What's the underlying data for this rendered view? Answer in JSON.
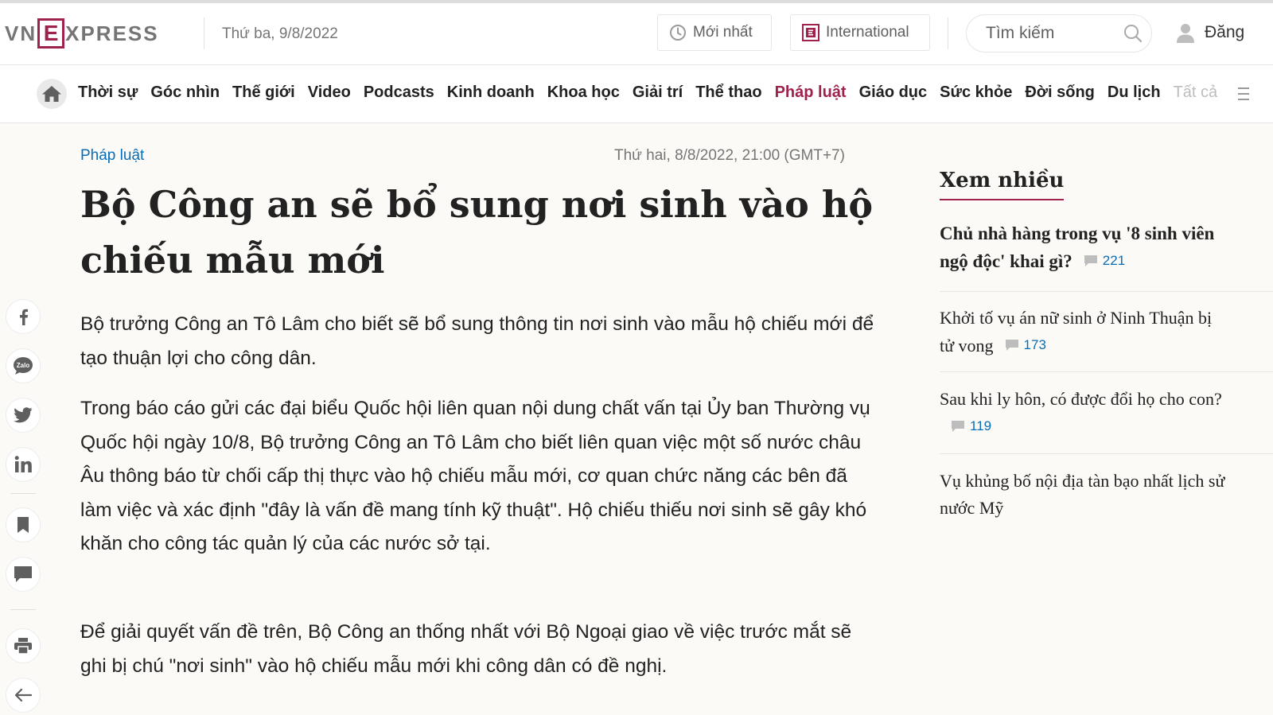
{
  "header": {
    "logo": {
      "left": "VN",
      "box": "E",
      "right": "XPRESS"
    },
    "date": "Thứ ba, 9/8/2022",
    "latest_label": "Mới nhất",
    "latest_icon": "clock-icon",
    "international_label": "International",
    "international_icon": "e-logo-icon",
    "search_placeholder": "Tìm kiếm",
    "login_label": "Đăng"
  },
  "nav": {
    "items": [
      "Thời sự",
      "Góc nhìn",
      "Thế giới",
      "Video",
      "Podcasts",
      "Kinh doanh",
      "Khoa học",
      "Giải trí",
      "Thể thao",
      "Pháp luật",
      "Giáo dục",
      "Sức khỏe",
      "Đời sống",
      "Du lịch"
    ],
    "active": "Pháp luật",
    "all_label": "Tất cả"
  },
  "article": {
    "category": "Pháp luật",
    "published": "Thứ hai, 8/8/2022, 21:00 (GMT+7)",
    "title": "Bộ Công an sẽ bổ sung nơi sinh vào hộ chiếu mẫu mới",
    "lead": "Bộ trưởng Công an Tô Lâm cho biết sẽ bổ sung thông tin nơi sinh vào mẫu hộ chiếu mới để tạo thuận lợi cho công dân.",
    "paragraphs": [
      "Trong báo cáo gửi các đại biểu Quốc hội liên quan nội dung chất vấn tại Ủy ban Thường vụ Quốc hội ngày 10/8, Bộ trưởng Công an Tô Lâm cho biết liên quan việc một số nước châu Âu thông báo từ chối cấp thị thực vào hộ chiếu mẫu mới, cơ quan chức năng các bên đã làm việc và xác định \"đây là vấn đề mang tính kỹ thuật\". Hộ chiếu thiếu nơi sinh sẽ gây khó khăn cho công tác quản lý của các nước sở tại.",
      "Để giải quyết vấn đề trên, Bộ Công an thống nhất với Bộ Ngoại giao về việc trước mắt sẽ ghi bị chú \"nơi sinh\" vào hộ chiếu mẫu mới khi công dân có đề nghị."
    ]
  },
  "social": [
    "facebook-icon",
    "zalo-icon",
    "twitter-icon",
    "linkedin-icon",
    "bookmark-icon",
    "comment-icon",
    "print-icon",
    "back-arrow-icon"
  ],
  "sidebar": {
    "heading": "Xem nhiều",
    "items": [
      {
        "line1": "Chủ nhà hàng trong vụ '8 sinh viên",
        "line2": "ngộ độc' khai gì?",
        "comments": "221"
      },
      {
        "line1": "Khởi tố vụ án nữ sinh ở Ninh Thuận bị",
        "line2": "tử vong",
        "comments": "173"
      },
      {
        "line1": "Sau khi ly hôn, có được đổi họ cho con?",
        "line2": "",
        "comments": "119"
      },
      {
        "line1": "Vụ khủng bố nội địa tàn bạo nhất lịch sử",
        "line2": "nước Mỹ",
        "comments": ""
      }
    ]
  },
  "colors": {
    "brand": "#9f224e",
    "link": "#076db6",
    "background": "#fcfaf6"
  }
}
